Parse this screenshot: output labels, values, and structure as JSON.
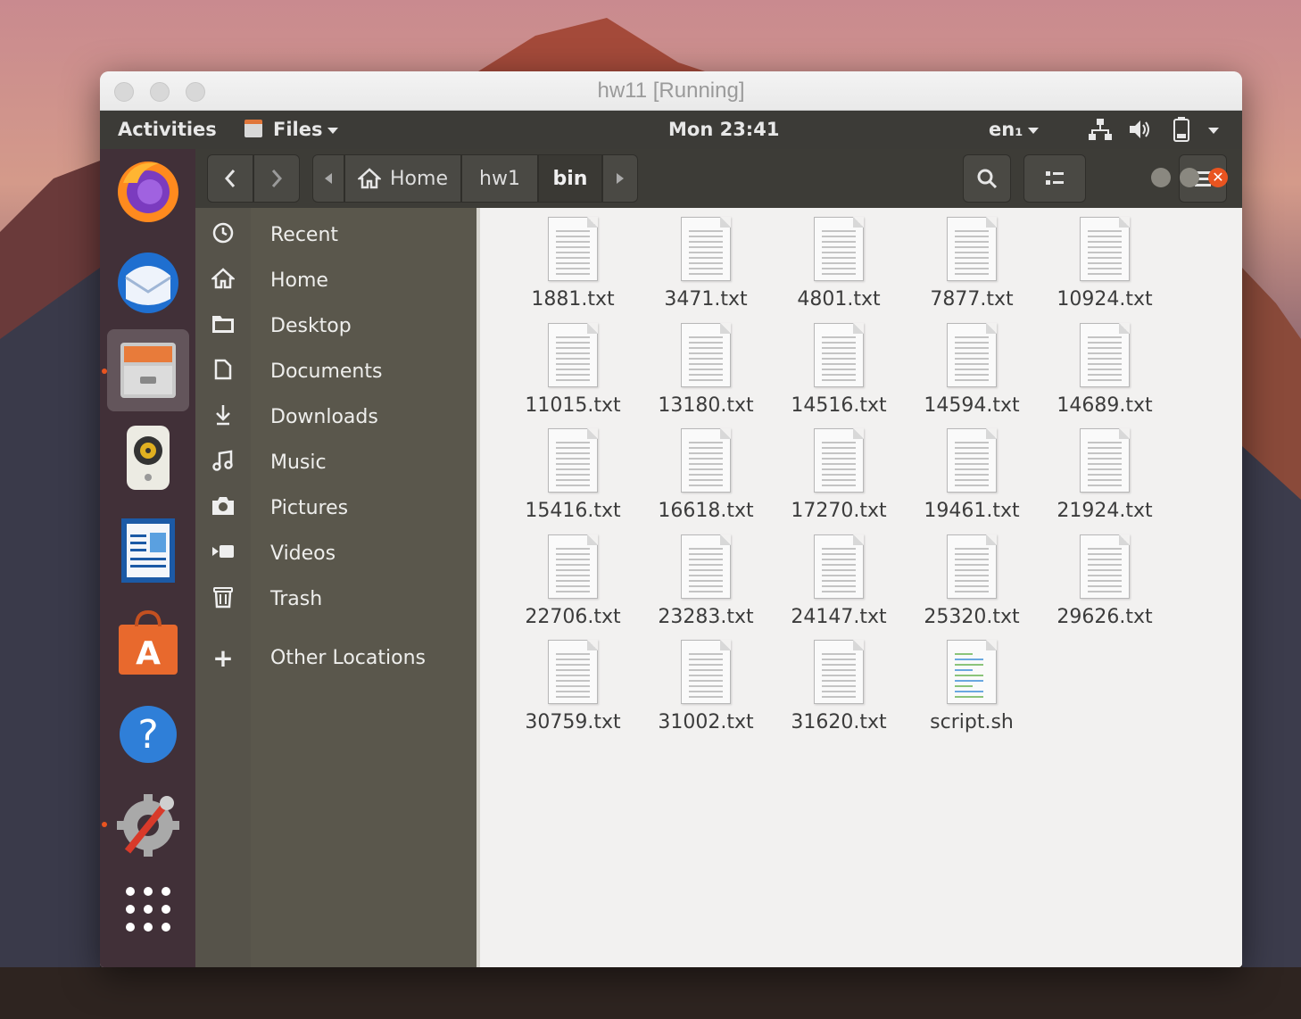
{
  "host_window": {
    "title": "hw11 [Running]"
  },
  "topbar": {
    "activities": "Activities",
    "app_menu": "Files",
    "clock": "Mon 23:41",
    "input_method": "en₁"
  },
  "dock": {
    "items": [
      {
        "name": "firefox",
        "running": false
      },
      {
        "name": "thunderbird",
        "running": false
      },
      {
        "name": "files",
        "running": true
      },
      {
        "name": "rhythmbox",
        "running": false
      },
      {
        "name": "libreoffice-writer",
        "running": false
      },
      {
        "name": "ubuntu-software",
        "running": false
      },
      {
        "name": "help",
        "running": false
      },
      {
        "name": "settings",
        "running": true
      },
      {
        "name": "show-applications",
        "running": false
      }
    ]
  },
  "header": {
    "breadcrumbs": [
      "Home",
      "hw1",
      "bin"
    ]
  },
  "sidebar": {
    "items": [
      {
        "label": "Recent",
        "icon": "clock-icon"
      },
      {
        "label": "Home",
        "icon": "home-icon"
      },
      {
        "label": "Desktop",
        "icon": "folder-icon"
      },
      {
        "label": "Documents",
        "icon": "document-icon"
      },
      {
        "label": "Downloads",
        "icon": "download-icon"
      },
      {
        "label": "Music",
        "icon": "music-icon"
      },
      {
        "label": "Pictures",
        "icon": "camera-icon"
      },
      {
        "label": "Videos",
        "icon": "video-icon"
      },
      {
        "label": "Trash",
        "icon": "trash-icon"
      },
      {
        "label": "Other Locations",
        "icon": "plus-icon"
      }
    ]
  },
  "files": [
    "1881.txt",
    "3471.txt",
    "4801.txt",
    "7877.txt",
    "10924.txt",
    "11015.txt",
    "13180.txt",
    "14516.txt",
    "14594.txt",
    "14689.txt",
    "15416.txt",
    "16618.txt",
    "17270.txt",
    "19461.txt",
    "21924.txt",
    "22706.txt",
    "23283.txt",
    "24147.txt",
    "25320.txt",
    "29626.txt",
    "30759.txt",
    "31002.txt",
    "31620.txt",
    "script.sh"
  ]
}
